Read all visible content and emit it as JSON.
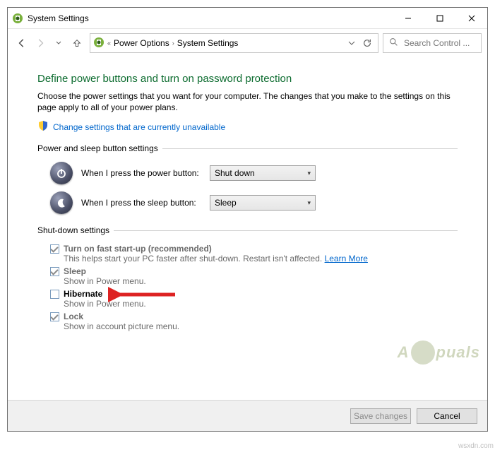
{
  "window": {
    "title": "System Settings"
  },
  "breadcrumb": {
    "prefix": "«",
    "items": [
      "Power Options",
      "System Settings"
    ]
  },
  "search": {
    "placeholder": "Search Control ..."
  },
  "page": {
    "heading": "Define power buttons and turn on password protection",
    "subtext": "Choose the power settings that you want for your computer. The changes that you make to the settings on this page apply to all of your power plans.",
    "admin_link": "Change settings that are currently unavailable"
  },
  "power_section": {
    "title": "Power and sleep button settings",
    "power_label": "When I press the power button:",
    "power_value": "Shut down",
    "sleep_label": "When I press the sleep button:",
    "sleep_value": "Sleep"
  },
  "shutdown_section": {
    "title": "Shut-down settings",
    "items": [
      {
        "label": "Turn on fast start-up (recommended)",
        "sub": "This helps start your PC faster after shut-down. Restart isn't affected.",
        "link": "Learn More",
        "checked": true,
        "bold": true,
        "disabled": true
      },
      {
        "label": "Sleep",
        "sub": "Show in Power menu.",
        "checked": true,
        "bold": true,
        "disabled": true
      },
      {
        "label": "Hibernate",
        "sub": "Show in Power menu.",
        "checked": false,
        "bold": true,
        "disabled": false,
        "highlighted": true
      },
      {
        "label": "Lock",
        "sub": "Show in account picture menu.",
        "checked": true,
        "bold": true,
        "disabled": true
      }
    ]
  },
  "footer": {
    "save": "Save changes",
    "cancel": "Cancel"
  },
  "watermark": "Appuals",
  "source": "wsxdn.com"
}
